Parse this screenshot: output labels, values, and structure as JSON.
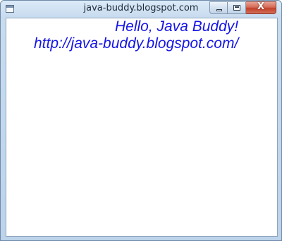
{
  "window": {
    "title": "java-buddy.blogspot.com",
    "controls": {
      "minimize_icon": "minimize-icon",
      "maximize_icon": "maximize-icon",
      "close_symbol": "X"
    }
  },
  "content": {
    "line1": "Hello, Java Buddy!",
    "line2": "http://java-buddy.blogspot.com/"
  },
  "colors": {
    "text": "#1515e6",
    "client_background": "#ffffff",
    "close_button": "#c2412a"
  }
}
